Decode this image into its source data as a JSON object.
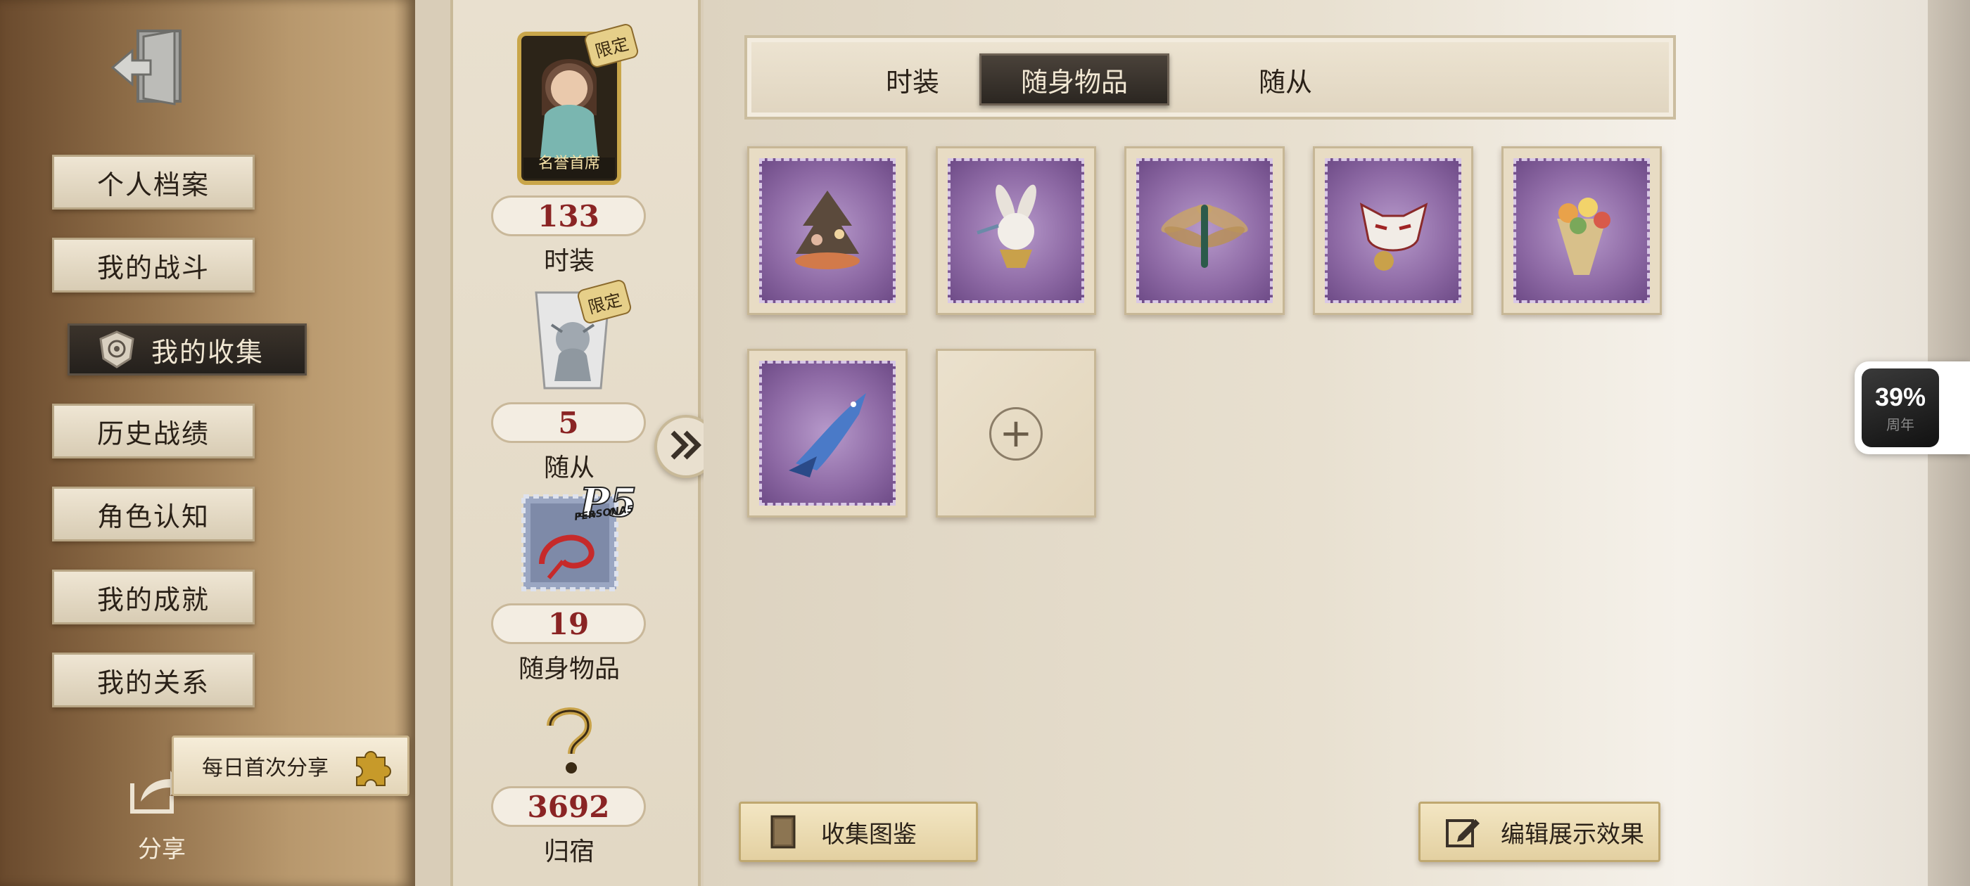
{
  "sidebar": {
    "items": [
      {
        "label": "个人档案"
      },
      {
        "label": "我的战斗"
      },
      {
        "label": "我的收集",
        "active": true
      },
      {
        "label": "历史战绩"
      },
      {
        "label": "角色认知"
      },
      {
        "label": "我的成就"
      },
      {
        "label": "我的关系"
      }
    ],
    "share_badge": "每日首次分享",
    "share_label": "分享"
  },
  "stats": {
    "costume": {
      "tag": "限定",
      "caption": "名誉首席",
      "value": "133",
      "label": "时装"
    },
    "follower": {
      "tag": "限定",
      "value": "5",
      "label": "随从"
    },
    "accessory": {
      "brand": "P5",
      "brand_sub": "PERSONA5",
      "value": "19",
      "label": "随身物品"
    },
    "home": {
      "value": "3692",
      "label": "归宿"
    }
  },
  "tabs": [
    {
      "label": "时装"
    },
    {
      "label": "随身物品",
      "active": true
    },
    {
      "label": "随从"
    }
  ],
  "items": [
    {
      "icon": "ornament-tree-icon"
    },
    {
      "icon": "bunny-figure-icon"
    },
    {
      "icon": "dragonfly-icon"
    },
    {
      "icon": "mask-bell-icon"
    },
    {
      "icon": "flower-bouquet-icon"
    },
    {
      "icon": "blue-shark-icon"
    },
    {
      "icon": "add-icon",
      "empty": true
    }
  ],
  "buttons": {
    "collection_guide": "收集图鉴",
    "edit_display": "编辑展示效果"
  },
  "widget": {
    "percent": "39%",
    "sub": "周年"
  },
  "colors": {
    "accent_dark": "#2b2621",
    "value_red": "#8a2424",
    "stamp_purple": "#8e6aa5"
  }
}
